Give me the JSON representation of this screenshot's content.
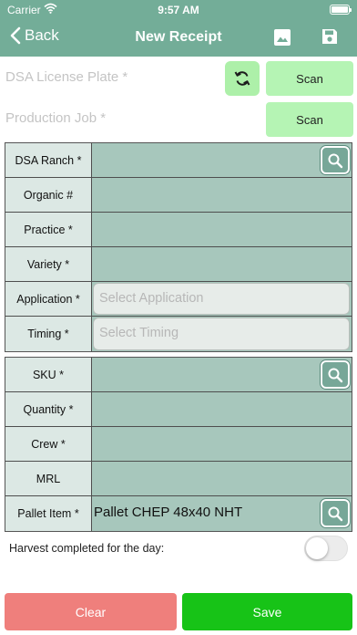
{
  "status_bar": {
    "carrier": "Carrier",
    "time": "9:57 AM"
  },
  "nav": {
    "back_label": "Back",
    "title": "New Receipt"
  },
  "top_fields": {
    "license_plate_label": "DSA License Plate *",
    "production_job_label": "Production Job *",
    "scan_label": "Scan"
  },
  "table1": {
    "ranch_label": "DSA Ranch *",
    "organic_label": "Organic #",
    "practice_label": "Practice *",
    "variety_label": "Variety *",
    "application_label": "Application *",
    "application_placeholder": "Select Application",
    "timing_label": "Timing *",
    "timing_placeholder": "Select Timing"
  },
  "table2": {
    "sku_label": "SKU *",
    "quantity_label": "Quantity *",
    "crew_label": "Crew *",
    "mrl_label": "MRL",
    "pallet_label": "Pallet Item *",
    "pallet_value": "Pallet CHEP 48x40 NHT"
  },
  "harvest": {
    "label": "Harvest completed for the day:",
    "completed": false
  },
  "buttons": {
    "clear": "Clear",
    "save": "Save"
  },
  "colors": {
    "header": "#73ad98",
    "scan_button": "#b5f4b4",
    "table_value_bg": "#a7c7bc",
    "table_label_bg": "#dce8e4",
    "clear_button": "#ef7f7c",
    "save_button": "#17c317"
  },
  "icons": {
    "status": [
      "wifi-icon",
      "battery-icon"
    ],
    "nav": [
      "chevron-left-icon",
      "image-icon",
      "floppy-save-icon"
    ],
    "fields": [
      "sync-icon",
      "search-icon"
    ]
  }
}
